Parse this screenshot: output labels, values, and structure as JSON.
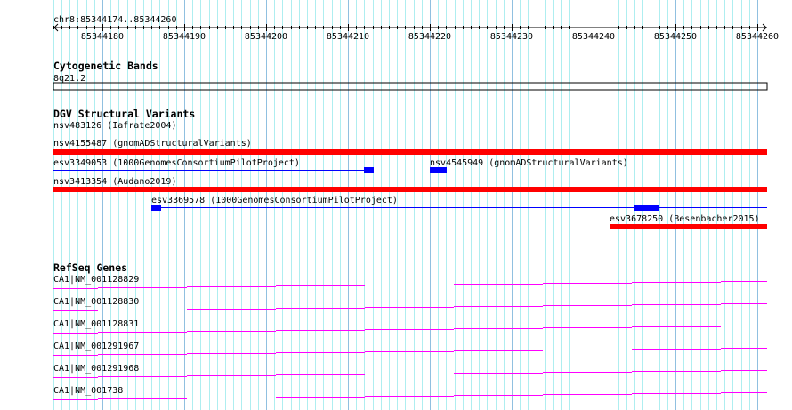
{
  "ruler": {
    "region": "chr8:85344174..85344260",
    "start": 85344174,
    "end": 85344260,
    "tick_labels": [
      "85344180",
      "85344190",
      "85344200",
      "85344210",
      "85344220",
      "85344230",
      "85344240",
      "85344250",
      "85344260"
    ]
  },
  "tracks": {
    "cytoband": {
      "title": "Cytogenetic Bands",
      "band": "8q21.2"
    },
    "dgv": {
      "title": "DGV Structural Variants",
      "features": [
        "nsv483126 (Iafrate2004)",
        "nsv4155487 (gnomADStructuralVariants)",
        "esv3349053 (1000GenomesConsortiumPilotProject)",
        "nsv4545949 (gnomADStructuralVariants)",
        "nsv3413354 (Audano2019)",
        "esv3369578 (1000GenomesConsortiumPilotProject)",
        "esv3678250 (Besenbacher2015)"
      ]
    },
    "refseq": {
      "title": "RefSeq Genes",
      "transcripts": [
        "CA1|NM_001128829",
        "CA1|NM_001128830",
        "CA1|NM_001128831",
        "CA1|NM_001291967",
        "CA1|NM_001291968",
        "CA1|NM_001738"
      ]
    }
  },
  "colors": {
    "grid_minor": "#aeeef0",
    "grid_major": "#90c0e0",
    "cnv_loss": "#ff0000",
    "cnv_gain": "#0000ff",
    "inversion": "#a0522d",
    "gene": "#ff00ff"
  }
}
